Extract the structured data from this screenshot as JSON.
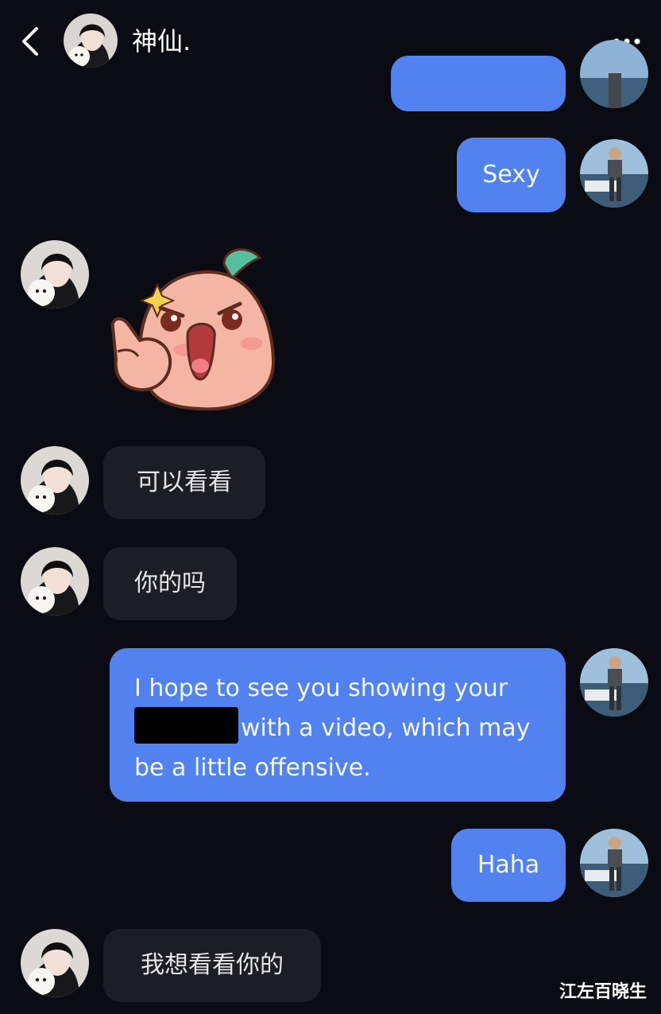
{
  "header": {
    "title": "神仙."
  },
  "messages": [
    {
      "from": "me",
      "text": "Sexy"
    },
    {
      "from": "them",
      "type": "sticker",
      "sticker": "pouting-peach-thumbs-up-sticker"
    },
    {
      "from": "them",
      "text": "可以看看"
    },
    {
      "from": "them",
      "text": "你的吗"
    },
    {
      "from": "me",
      "line1": "I hope to see you showing your",
      "line2": "with a video, which may",
      "line3": "be a little offensive."
    },
    {
      "from": "me",
      "text": "Haha"
    },
    {
      "from": "them",
      "text": "我想看看你的"
    }
  ],
  "watermark": "江左百晓生",
  "colors": {
    "background": "#0b0b14",
    "my_bubble": "#5282f0",
    "their_bubble": "#1d1d25"
  },
  "icons": [
    "back-chevron-icon",
    "more-options-icon"
  ]
}
